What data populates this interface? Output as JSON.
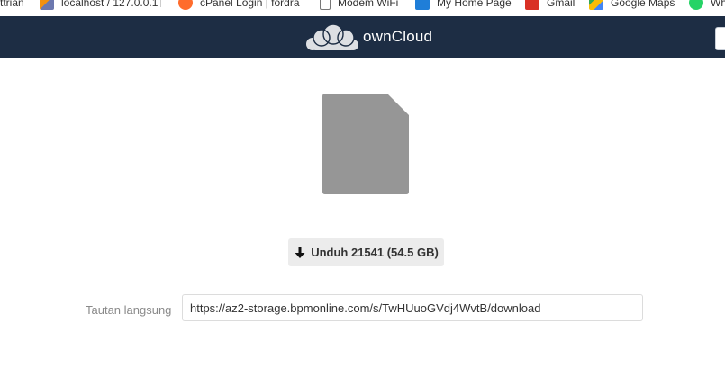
{
  "bookmarks": [
    {
      "label": "ttrian",
      "icon": "blank"
    },
    {
      "label": "localhost / 127.0.0.1",
      "icon": "phpmyadmin-icon"
    },
    {
      "label": "cPanel Login | fordra",
      "icon": "cpanel-icon"
    },
    {
      "label": "Modem WiFi",
      "icon": "page-icon"
    },
    {
      "label": "My Home Page",
      "icon": "home-page-icon"
    },
    {
      "label": "Gmail",
      "icon": "gmail-icon"
    },
    {
      "label": "Google Maps",
      "icon": "google-maps-icon"
    },
    {
      "label": "Wh",
      "icon": "whatsapp-icon"
    }
  ],
  "header": {
    "brand": "ownCloud",
    "color": "#1d2d44"
  },
  "file": {
    "icon": "file-icon",
    "color": "#969696"
  },
  "download": {
    "label": "Unduh 21541 (54.5 GB)"
  },
  "direct_link": {
    "label": "Tautan langsung",
    "value": "https://az2-storage.bpmonline.com/s/TwHUuoGVdj4WvtB/download"
  }
}
